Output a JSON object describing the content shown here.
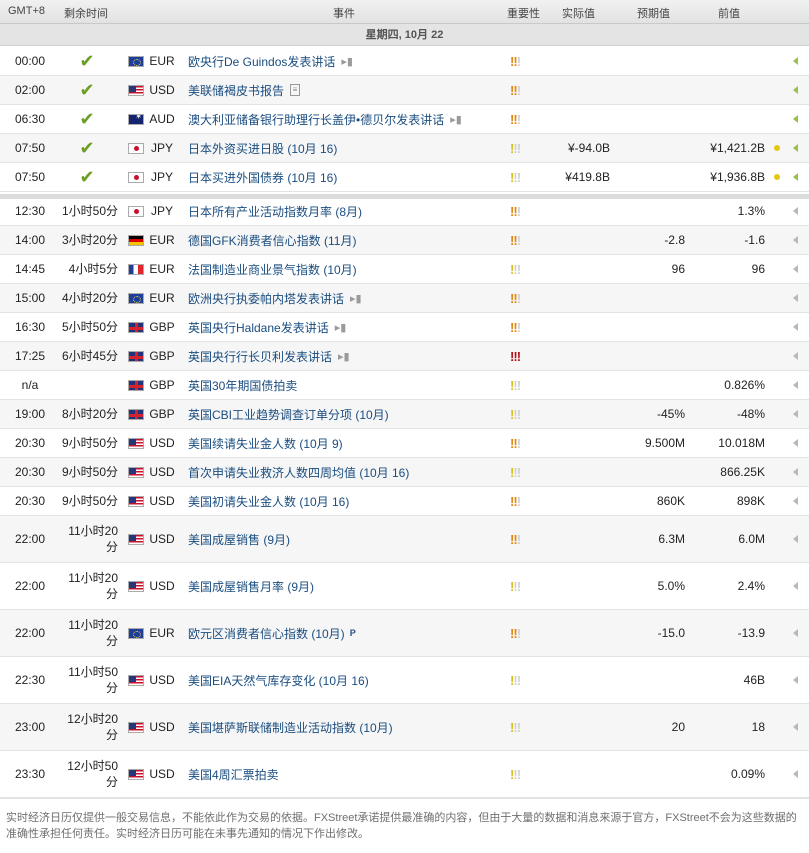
{
  "header": {
    "gmt": "GMT+8",
    "remaining": "剩余时间",
    "event": "事件",
    "importance": "重要性",
    "actual": "实际值",
    "forecast": "预期值",
    "previous": "前值"
  },
  "day_label": "星期四, 10月 22",
  "past_events": [
    {
      "time": "00:00",
      "currency": "EUR",
      "flag": "eu-flag",
      "event": "欧央行De Guindos发表讲话",
      "extra_icon": "microphone-icon",
      "importance": 2,
      "actual": "",
      "forecast": "",
      "previous": ""
    },
    {
      "time": "02:00",
      "currency": "USD",
      "flag": "us-flag",
      "event": "美联储褐皮书报告",
      "extra_icon": "document-icon",
      "importance": 2,
      "actual": "",
      "forecast": "",
      "previous": ""
    },
    {
      "time": "06:30",
      "currency": "AUD",
      "flag": "au-flag",
      "event": "澳大利亚储备银行助理行长盖伊•德贝尔发表讲话",
      "extra_icon": "microphone-icon",
      "importance": 2,
      "actual": "",
      "forecast": "",
      "previous": ""
    },
    {
      "time": "07:50",
      "currency": "JPY",
      "flag": "jp-flag",
      "event": "日本外资买进日股 (10月 16)",
      "extra_icon": "",
      "importance": 1,
      "actual": "¥-94.0B",
      "forecast": "",
      "previous": "¥1,421.2B"
    },
    {
      "time": "07:50",
      "currency": "JPY",
      "flag": "jp-flag",
      "event": "日本买进外国债券 (10月 16)",
      "extra_icon": "",
      "importance": 1,
      "actual": "¥419.8B",
      "forecast": "",
      "previous": "¥1,936.8B"
    }
  ],
  "upcoming_events": [
    {
      "time": "12:30",
      "remaining": "1小时50分",
      "currency": "JPY",
      "flag": "jp-flag",
      "event": "日本所有产业活动指数月率 (8月)",
      "extra_icon": "",
      "importance": 2,
      "forecast": "",
      "previous": "1.3%"
    },
    {
      "time": "14:00",
      "remaining": "3小时20分",
      "currency": "EUR",
      "flag": "de-flag",
      "event": "德国GFK消费者信心指数 (11月)",
      "extra_icon": "",
      "importance": 2,
      "forecast": "-2.8",
      "previous": "-1.6"
    },
    {
      "time": "14:45",
      "remaining": "4小时5分",
      "currency": "EUR",
      "flag": "fr-flag",
      "event": "法国制造业商业景气指数 (10月)",
      "extra_icon": "",
      "importance": 1,
      "forecast": "96",
      "previous": "96"
    },
    {
      "time": "15:00",
      "remaining": "4小时20分",
      "currency": "EUR",
      "flag": "eu-flag",
      "event": "欧洲央行执委帕内塔发表讲话",
      "extra_icon": "microphone-icon",
      "importance": 2,
      "forecast": "",
      "previous": ""
    },
    {
      "time": "16:30",
      "remaining": "5小时50分",
      "currency": "GBP",
      "flag": "gb-flag",
      "event": "英国央行Haldane发表讲话",
      "extra_icon": "microphone-icon",
      "importance": 2,
      "forecast": "",
      "previous": ""
    },
    {
      "time": "17:25",
      "remaining": "6小时45分",
      "currency": "GBP",
      "flag": "gb-flag",
      "event": "英国央行行长贝利发表讲话",
      "extra_icon": "microphone-icon",
      "importance": 3,
      "forecast": "",
      "previous": ""
    },
    {
      "time": "n/a",
      "remaining": "",
      "currency": "GBP",
      "flag": "gb-flag",
      "event": "英国30年期国债拍卖",
      "extra_icon": "",
      "importance": 1,
      "forecast": "",
      "previous": "0.826%"
    },
    {
      "time": "19:00",
      "remaining": "8小时20分",
      "currency": "GBP",
      "flag": "gb-flag",
      "event": "英国CBI工业趋势调查订单分项 (10月)",
      "extra_icon": "",
      "importance": 1,
      "forecast": "-45%",
      "previous": "-48%"
    },
    {
      "time": "20:30",
      "remaining": "9小时50分",
      "currency": "USD",
      "flag": "us-flag",
      "event": "美国续请失业金人数 (10月 9)",
      "extra_icon": "",
      "importance": 2,
      "forecast": "9.500M",
      "previous": "10.018M"
    },
    {
      "time": "20:30",
      "remaining": "9小时50分",
      "currency": "USD",
      "flag": "us-flag",
      "event": "首次申请失业救济人数四周均值 (10月 16)",
      "extra_icon": "",
      "importance": 1,
      "forecast": "",
      "previous": "866.25K"
    },
    {
      "time": "20:30",
      "remaining": "9小时50分",
      "currency": "USD",
      "flag": "us-flag",
      "event": "美国初请失业金人数 (10月 16)",
      "extra_icon": "",
      "importance": 2,
      "forecast": "860K",
      "previous": "898K"
    },
    {
      "time": "22:00",
      "remaining_line1": "11小时20",
      "remaining_line2": "分",
      "currency": "USD",
      "flag": "us-flag",
      "event": "美国成屋销售 (9月)",
      "extra_icon": "",
      "importance": 2,
      "forecast": "6.3M",
      "previous": "6.0M"
    },
    {
      "time": "22:00",
      "remaining_line1": "11小时20",
      "remaining_line2": "分",
      "currency": "USD",
      "flag": "us-flag",
      "event": "美国成屋销售月率 (9月)",
      "extra_icon": "",
      "importance": 1,
      "forecast": "5.0%",
      "previous": "2.4%"
    },
    {
      "time": "22:00",
      "remaining_line1": "11小时20",
      "remaining_line2": "分",
      "currency": "EUR",
      "flag": "eu-flag",
      "event": "欧元区消费者信心指数 (10月)",
      "extra_icon": "p-icon",
      "importance": 2,
      "forecast": "-15.0",
      "previous": "-13.9"
    },
    {
      "time": "22:30",
      "remaining_line1": "11小时50",
      "remaining_line2": "分",
      "currency": "USD",
      "flag": "us-flag",
      "event": "美国EIA天然气库存变化 (10月 16)",
      "extra_icon": "",
      "importance": 1,
      "forecast": "",
      "previous": "46B"
    },
    {
      "time": "23:00",
      "remaining_line1": "12小时20",
      "remaining_line2": "分",
      "currency": "USD",
      "flag": "us-flag",
      "event": "美国堪萨斯联储制造业活动指数 (10月)",
      "extra_icon": "",
      "importance": 1,
      "forecast": "20",
      "previous": "18"
    },
    {
      "time": "23:30",
      "remaining_line1": "12小时50",
      "remaining_line2": "分",
      "currency": "USD",
      "flag": "us-flag",
      "event": "美国4周汇票拍卖",
      "extra_icon": "",
      "importance": 1,
      "forecast": "",
      "previous": "0.09%"
    }
  ],
  "footer": "实时经济日历仅提供一般交易信息，不能依此作为交易的依据。FXStreet承诺提供最准确的内容，但由于大量的数据和消息来源于官方，FXStreet不会为这些数据的准确性承担任何责任。实时经济日历可能在未事先通知的情况下作出修改。",
  "colors": {
    "low": "#d6c21c",
    "mid": "#e38712",
    "high": "#b5121b",
    "link": "#1a4d80"
  }
}
